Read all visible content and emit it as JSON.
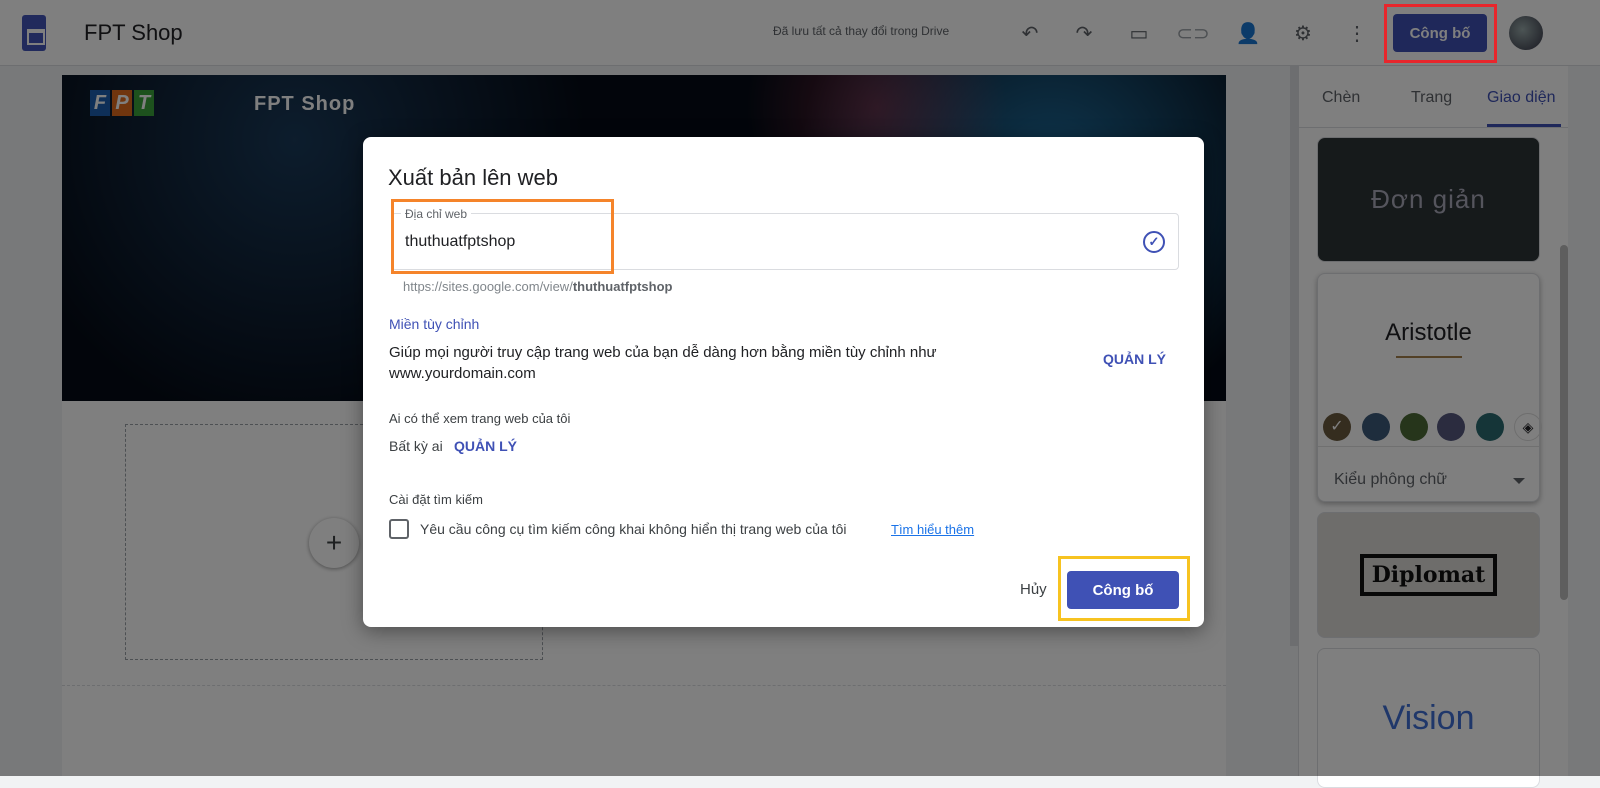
{
  "header": {
    "site_name": "FPT Shop",
    "save_status": "Đã lưu tất cả thay đổi trong Drive",
    "publish_label": "Công bố"
  },
  "canvas": {
    "banner_title": "FPT Shop",
    "logo_letters": [
      "F",
      "P",
      "T"
    ],
    "add_symbol": "+"
  },
  "panel": {
    "tabs": [
      "Chèn",
      "Trang",
      "Giao diện"
    ],
    "themes": [
      "Đơn giản",
      "Aristotle",
      "Diplomat",
      "Vision"
    ],
    "font_select": "Kiểu phông chữ",
    "colors": [
      "#6b5a3e",
      "#3d5a7a",
      "#4d6b36",
      "#56587f",
      "#2a6b70"
    ]
  },
  "dialog": {
    "title": "Xuất bản lên web",
    "field_label": "Địa chỉ web",
    "field_value": "thuthuatfptshop",
    "url_prefix": "https://sites.google.com/view/",
    "url_slug": "thuthuatfptshop",
    "domain_heading": "Miền tùy chỉnh",
    "domain_desc": "Giúp mọi người truy cập trang web của bạn dễ dàng hơn bằng miền tùy chỉnh như www.yourdomain.com",
    "manage": "QUẢN LÝ",
    "who_heading": "Ai có thể xem trang web của tôi",
    "who_value": "Bất kỳ ai",
    "search_heading": "Cài đặt tìm kiếm",
    "search_checkbox": "Yêu cầu công cụ tìm kiếm công khai không hiển thị trang web của tôi",
    "learn_more": "Tìm hiểu thêm",
    "cancel": "Hủy",
    "publish": "Công bố"
  }
}
